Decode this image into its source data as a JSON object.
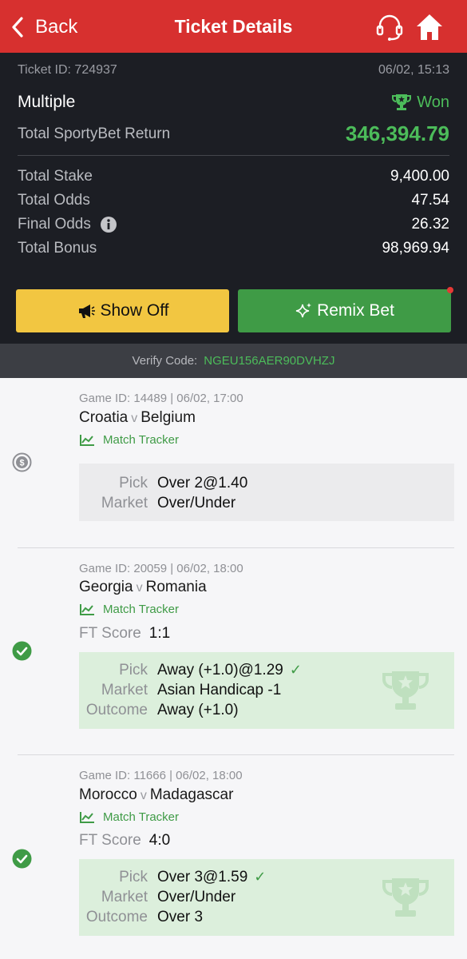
{
  "header": {
    "back_label": "Back",
    "title": "Ticket Details",
    "support_icon": "headset-icon",
    "home_icon": "home-icon",
    "background": "#d7302f"
  },
  "ticket": {
    "id_label": "Ticket ID: 724937",
    "datetime": "06/02, 15:13",
    "type": "Multiple",
    "status": "Won",
    "return_label": "Total SportyBet Return",
    "return_value": "346,394.79",
    "stake_label": "Total Stake",
    "stake_value": "9,400.00",
    "odds_label": "Total Odds",
    "odds_value": "47.54",
    "final_odds_label": "Final Odds",
    "final_odds_value": "26.32",
    "bonus_label": "Total Bonus",
    "bonus_value": "98,969.94"
  },
  "actions": {
    "show_off": "Show Off",
    "remix": "Remix Bet"
  },
  "verify": {
    "label": "Verify Code:",
    "code": "NGEU156AER90DVHZJ"
  },
  "bets": [
    {
      "game": "Game ID: 14489 | 06/02, 17:00",
      "home": "Croatia",
      "vs": "v",
      "away": "Belgium",
      "tracker": "Match Tracker",
      "pick_label": "Pick",
      "pick": "Over 2@1.40",
      "market_label": "Market",
      "market": "Over/Under"
    },
    {
      "game": "Game ID: 20059 | 06/02, 18:00",
      "home": "Georgia",
      "vs": "v",
      "away": "Romania",
      "tracker": "Match Tracker",
      "ft_label": "FT Score",
      "ft_score": "1:1",
      "pick_label": "Pick",
      "pick": "Away (+1.0)@1.29",
      "market_label": "Market",
      "market": "Asian Handicap -1",
      "outcome_label": "Outcome",
      "outcome": "Away (+1.0)"
    },
    {
      "game": "Game ID: 11666 | 06/02, 18:00",
      "home": "Morocco",
      "vs": "v",
      "away": "Madagascar",
      "tracker": "Match Tracker",
      "ft_label": "FT Score",
      "ft_score": "4:0",
      "pick_label": "Pick",
      "pick": "Over 3@1.59",
      "market_label": "Market",
      "market": "Over/Under",
      "outcome_label": "Outcome",
      "outcome": "Over 3"
    }
  ],
  "colors": {
    "accent_green": "#3f9b46",
    "won_green": "#4cbc5a",
    "show_off_yellow": "#f2c641",
    "panel_dark": "#1c1e24"
  }
}
